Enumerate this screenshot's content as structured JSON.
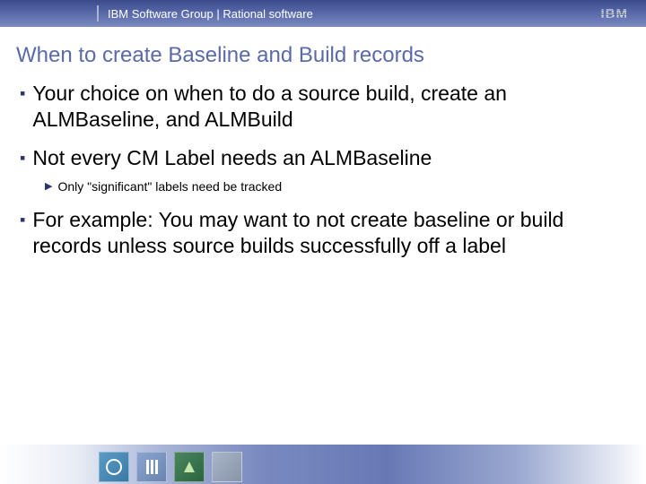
{
  "header": {
    "group_label": "IBM Software Group | Rational software",
    "logo_text": "IBM"
  },
  "title": "When to create Baseline and Build records",
  "bullets": [
    {
      "text": "Your choice on when to do a source build, create an ALMBaseline, and ALMBuild",
      "sub": []
    },
    {
      "text": "Not every CM Label needs an ALMBaseline",
      "sub": [
        "Only \"significant\" labels need be tracked"
      ]
    },
    {
      "text": "For example: You may want to not create baseline or build records unless source builds successfully off a label",
      "sub": []
    }
  ]
}
